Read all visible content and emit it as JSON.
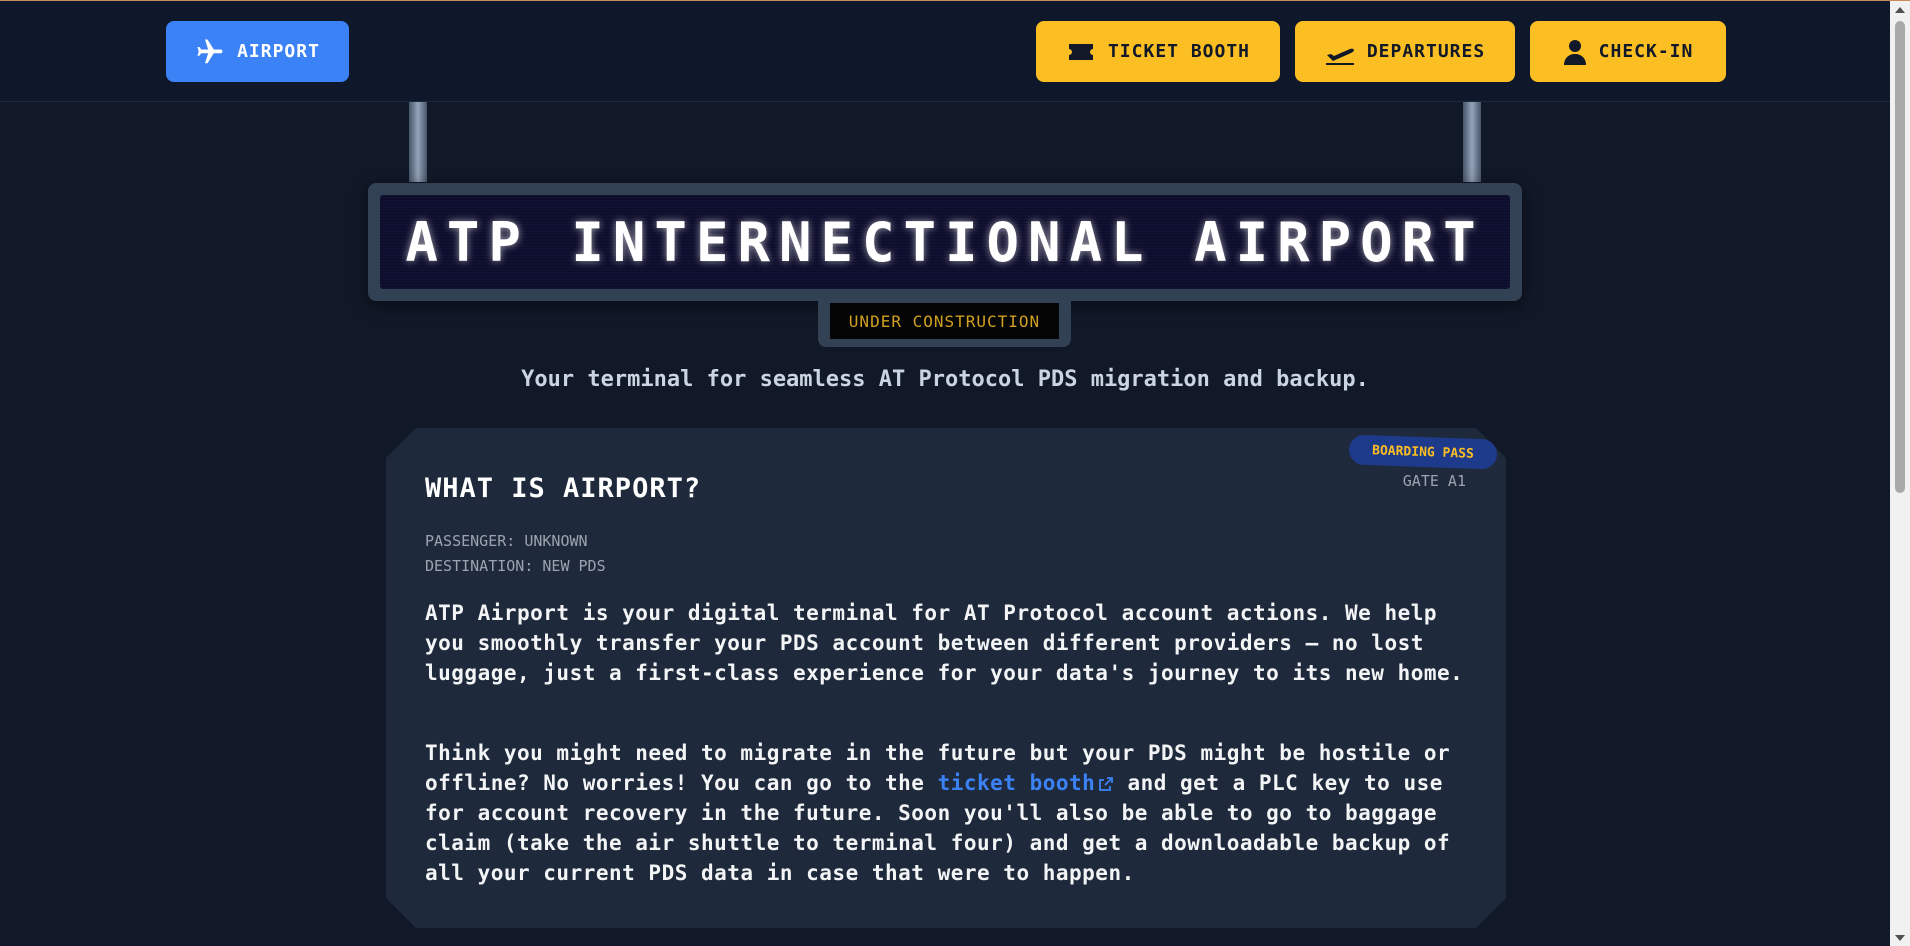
{
  "nav": {
    "home_label": "AIRPORT",
    "ticket_label": "TICKET BOOTH",
    "departures_label": "DEPARTURES",
    "checkin_label": "CHECK-IN"
  },
  "hero": {
    "title": "ATP INTERNECTIONAL AIRPORT",
    "status": "UNDER CONSTRUCTION",
    "tagline": "Your terminal for seamless AT Protocol PDS migration and backup."
  },
  "card": {
    "badge": "BOARDING PASS",
    "gate": "GATE A1",
    "title": "WHAT IS AIRPORT?",
    "passenger": "PASSENGER: UNKNOWN",
    "destination": "DESTINATION: NEW PDS",
    "para1": "ATP Airport is your digital terminal for AT Protocol account actions. We help you smoothly transfer your PDS account between different providers – no lost luggage, just a first-class experience for your data's journey to its new home.",
    "para2_before": "Think you might need to migrate in the future but your PDS might be hostile or offline? No worries! You can go to the ",
    "para2_link": "ticket booth",
    "para2_after": " and get a PLC key to use for account recovery in the future. Soon you'll also be able to go to baggage claim (take the air shuttle to terminal four) and get a downloadable backup of all your current PDS data in case that were to happen."
  },
  "colors": {
    "background": "#111827",
    "navbar": "#0f172a",
    "primary_blue": "#3b82f6",
    "accent_yellow": "#fbbf24",
    "card": "#1e293b"
  },
  "icons": {
    "home": "airplane-icon",
    "ticket": "ticket-icon",
    "departures": "plane-departure-icon",
    "checkin": "user-icon",
    "link": "external-link-icon"
  }
}
